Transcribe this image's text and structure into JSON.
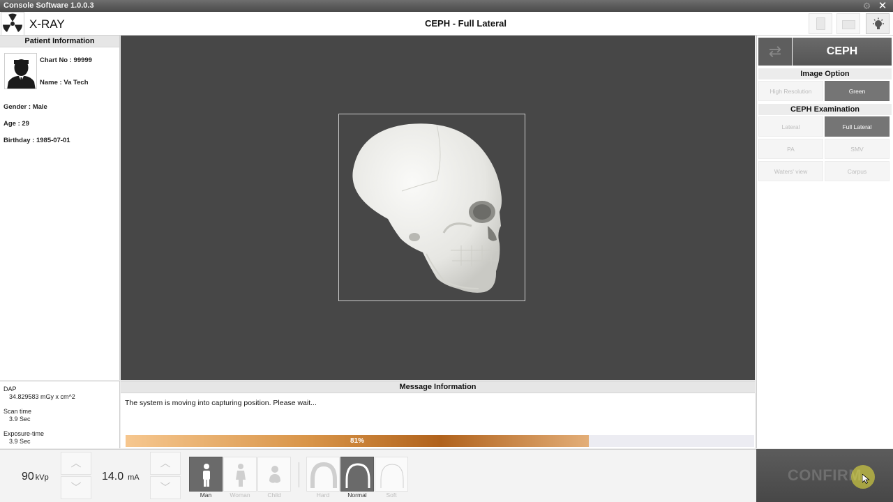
{
  "window": {
    "title": "Console Software  1.0.0.3"
  },
  "header": {
    "app_name": "X-RAY",
    "page_title": "CEPH - Full Lateral"
  },
  "patient": {
    "section_title": "Patient Information",
    "chart_no": "Chart No : 99999",
    "name": "Name : Va Tech",
    "gender": "Gender : Male",
    "age": "Age : 29",
    "birthday": "Birthday : 1985-07-01"
  },
  "stats": {
    "dap_label": "DAP",
    "dap_value": "34.829583 mGy x cm^2",
    "scan_label": "Scan time",
    "scan_value": "3.9 Sec",
    "exposure_label": "Exposure-time",
    "exposure_value": "3.9 Sec"
  },
  "message": {
    "section_title": "Message Information",
    "text": "The system is moving into capturing position. Please wait...",
    "progress_percent": 81,
    "progress_label": "81%"
  },
  "right_panel": {
    "mode_tab": "CEPH",
    "image_option_title": "Image Option",
    "image_options": [
      {
        "label": "High Resolution",
        "selected": false
      },
      {
        "label": "Green",
        "selected": true
      }
    ],
    "exam_title": "CEPH Examination",
    "exams": [
      {
        "label": "Lateral",
        "selected": false
      },
      {
        "label": "Full Lateral",
        "selected": true
      },
      {
        "label": "PA",
        "selected": false
      },
      {
        "label": "SMV",
        "selected": false
      },
      {
        "label": "Waters' view",
        "selected": false
      },
      {
        "label": "Carpus",
        "selected": false
      }
    ]
  },
  "controls": {
    "kvp_value": "90",
    "kvp_unit": "kVp",
    "ma_value": "14.0",
    "ma_unit": "mA",
    "patient_types": [
      {
        "label": "Man",
        "selected": true
      },
      {
        "label": "Woman",
        "selected": false
      },
      {
        "label": "Child",
        "selected": false
      }
    ],
    "arch_types": [
      {
        "label": "Hard",
        "selected": false
      },
      {
        "label": "Normal",
        "selected": true
      },
      {
        "label": "Soft",
        "selected": false
      }
    ]
  },
  "confirm_label": "CONFIRM",
  "colors": {
    "selected_gray": "#757575",
    "viewport_bg": "#474747",
    "progress_accent": "#b0621c"
  }
}
